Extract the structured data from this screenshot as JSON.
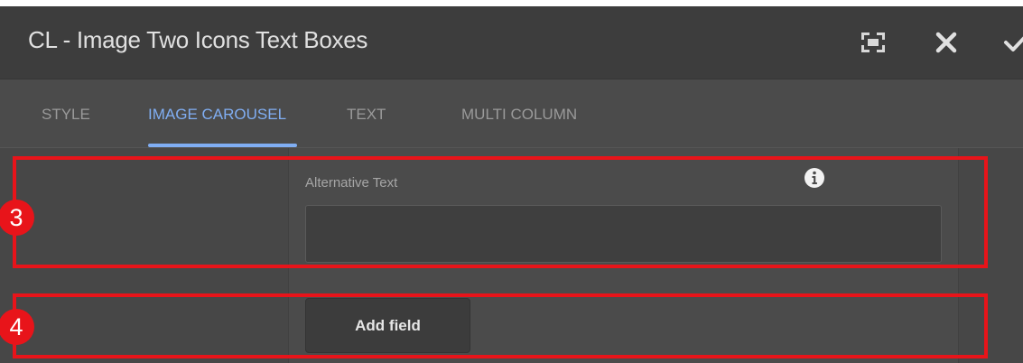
{
  "dialog": {
    "title": "CL - Image Two Icons Text Boxes",
    "header_icons": [
      "fullscreen-icon",
      "close-icon",
      "check-icon"
    ]
  },
  "tabs": [
    {
      "label": "STYLE",
      "active": false
    },
    {
      "label": "IMAGE CAROUSEL",
      "active": true
    },
    {
      "label": "TEXT",
      "active": false
    },
    {
      "label": "MULTI COLUMN",
      "active": false
    }
  ],
  "form": {
    "alt_text_label": "Alternative Text",
    "alt_text_value": "",
    "info_icon": "info-icon",
    "add_field_label": "Add field"
  },
  "annotations": [
    {
      "number": "3"
    },
    {
      "number": "4"
    }
  ],
  "colors": {
    "accent": "#80aef3",
    "highlight": "#e8141a",
    "titlebar": "#3d3d3d",
    "panel": "#4b4b4b"
  }
}
